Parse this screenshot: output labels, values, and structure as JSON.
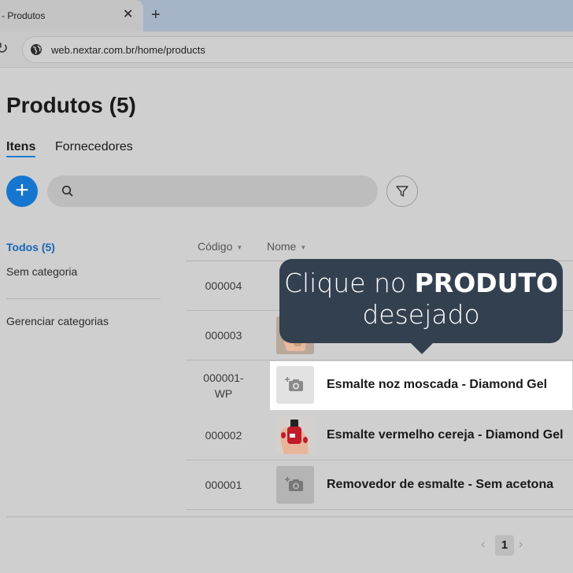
{
  "browser": {
    "tab_title": "- Produtos",
    "url": "web.nextar.com.br/home/products"
  },
  "page": {
    "title": "Produtos (5)",
    "tabs": [
      {
        "label": "Itens",
        "active": true
      },
      {
        "label": "Fornecedores",
        "active": false
      }
    ],
    "search_placeholder": ""
  },
  "sidebar": {
    "all_label": "Todos (5)",
    "uncategorized_label": "Sem categoria",
    "manage_label": "Gerenciar categorias"
  },
  "table": {
    "columns": [
      "Código",
      "Nome"
    ],
    "rows": [
      {
        "code": "000004",
        "name": "",
        "thumb": "none"
      },
      {
        "code": "000003",
        "name": "",
        "thumb": "hand-photo"
      },
      {
        "code": "000001-WP",
        "code_line1": "000001-",
        "code_line2": "WP",
        "name": "Esmalte noz moscada - Diamond Gel",
        "thumb": "camera-placeholder",
        "highlighted": true
      },
      {
        "code": "000002",
        "name": "Esmalte vermelho cereja - Diamond Gel",
        "thumb": "red-nail-polish-photo"
      },
      {
        "code": "000001",
        "name": "Removedor de esmalte - Sem acetona",
        "thumb": "camera-placeholder"
      }
    ]
  },
  "pagination": {
    "current_page": "1",
    "prev": "‹",
    "next": "›"
  },
  "callout": {
    "line1_prefix": "Clique no",
    "line1_bold": "PRODUTO",
    "line2": "desejado",
    "color": "#334050"
  },
  "colors": {
    "accent": "#1676cf",
    "link": "#1565b5"
  }
}
